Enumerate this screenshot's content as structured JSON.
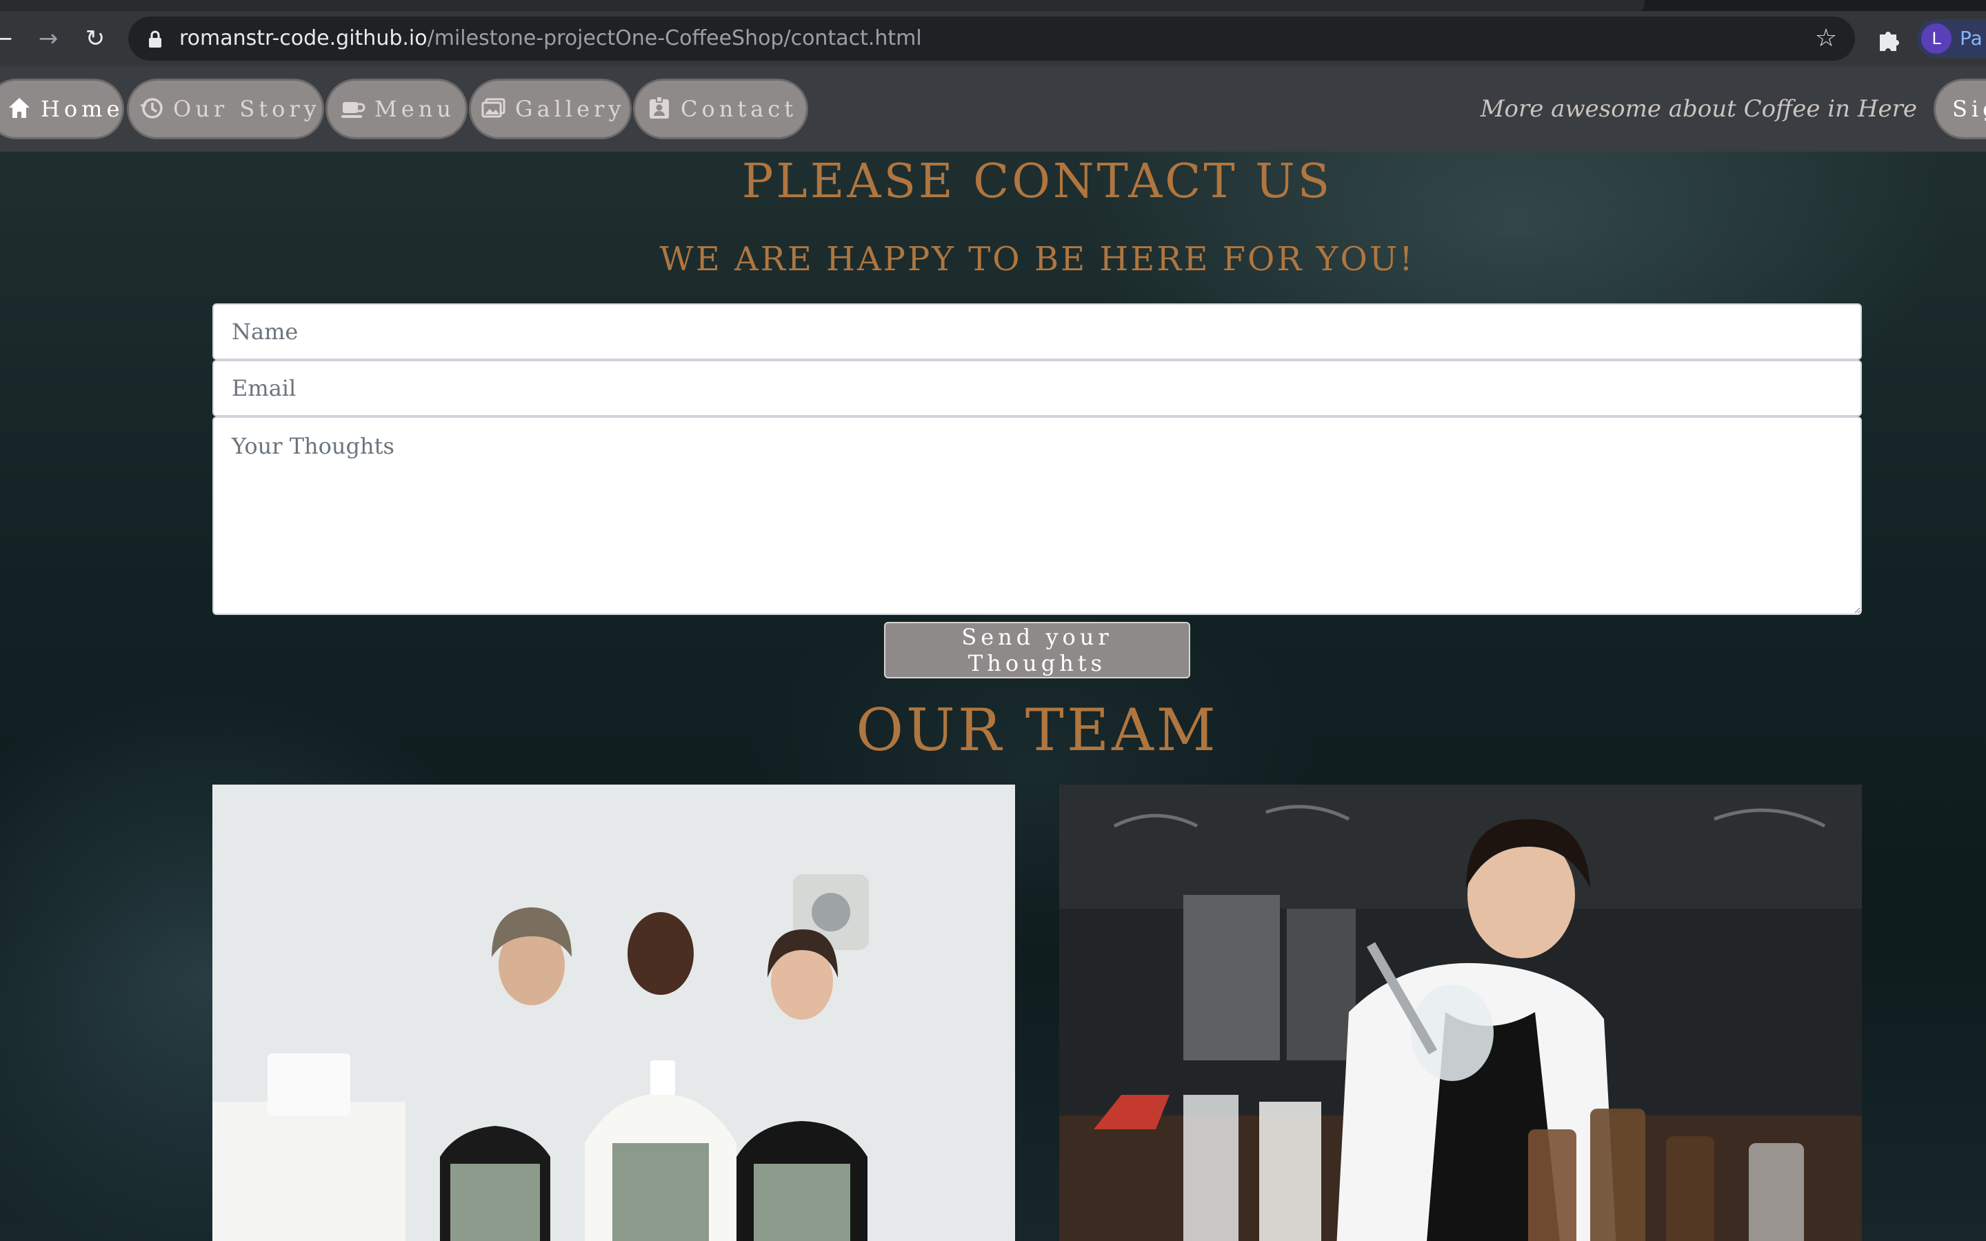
{
  "browser": {
    "url_host": "romanstr-code.github.io",
    "url_path": "/milestone-projectOne-CoffeeShop/contact.html",
    "profile_initial": "L",
    "profile_label": "Pa"
  },
  "nav": {
    "items": [
      {
        "label": "Home",
        "icon": "home-icon",
        "active": true
      },
      {
        "label": "Our Story",
        "icon": "history-icon",
        "active": false
      },
      {
        "label": "Menu",
        "icon": "coffee-cup-icon",
        "active": false
      },
      {
        "label": "Gallery",
        "icon": "images-icon",
        "active": false
      },
      {
        "label": "Contact",
        "icon": "contact-card-icon",
        "active": false
      }
    ],
    "tagline": "More awesome about Coffee in Here",
    "signin_label": "Sig"
  },
  "contact": {
    "title": "PLEASE CONTACT US",
    "subtitle": "WE ARE HAPPY TO BE HERE FOR YOU!",
    "name_placeholder": "Name",
    "email_placeholder": "Email",
    "thoughts_placeholder": "Your Thoughts",
    "send_label": "Send your Thoughts"
  },
  "team": {
    "title": "OUR TEAM"
  },
  "colors": {
    "accent": "#b0763f",
    "pill": "#8f8a8a",
    "navbar": "#3a3d41"
  }
}
